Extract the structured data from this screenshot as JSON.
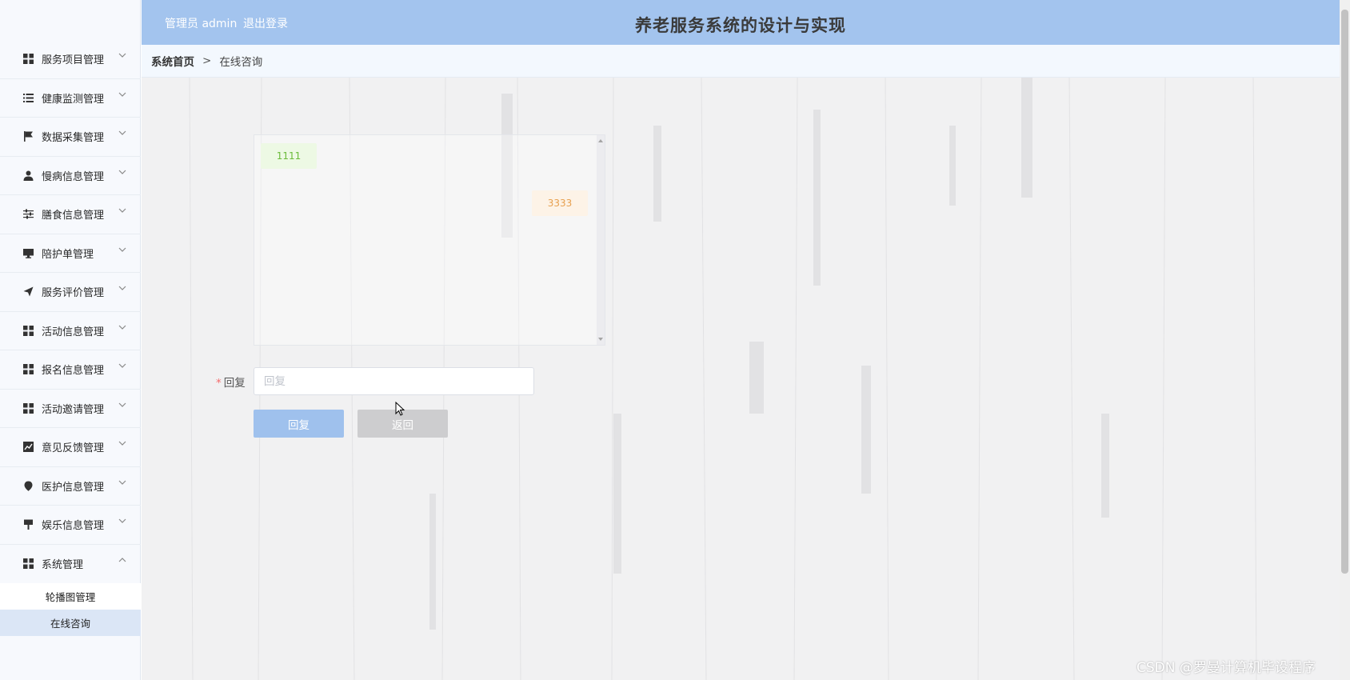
{
  "header": {
    "admin_label": "管理员 admin",
    "logout_label": "退出登录",
    "system_title": "养老服务系统的设计与实现"
  },
  "sidebar": {
    "items": [
      {
        "label": "服务项目管理",
        "icon": "grid-icon"
      },
      {
        "label": "健康监测管理",
        "icon": "list-icon"
      },
      {
        "label": "数据采集管理",
        "icon": "flag-icon"
      },
      {
        "label": "慢病信息管理",
        "icon": "user-icon"
      },
      {
        "label": "膳食信息管理",
        "icon": "sliders-icon"
      },
      {
        "label": "陪护单管理",
        "icon": "monitor-icon"
      },
      {
        "label": "服务评价管理",
        "icon": "send-icon"
      },
      {
        "label": "活动信息管理",
        "icon": "grid-icon"
      },
      {
        "label": "报名信息管理",
        "icon": "grid-icon"
      },
      {
        "label": "活动邀请管理",
        "icon": "grid-icon"
      },
      {
        "label": "意见反馈管理",
        "icon": "chart-icon"
      },
      {
        "label": "医护信息管理",
        "icon": "location-icon"
      },
      {
        "label": "娱乐信息管理",
        "icon": "pin-icon"
      },
      {
        "label": "系统管理",
        "icon": "grid-icon",
        "expanded": true
      }
    ],
    "submenu": [
      {
        "label": "轮播图管理",
        "active": false
      },
      {
        "label": "在线咨询",
        "active": true
      }
    ]
  },
  "breadcrumb": {
    "home": "系统首页",
    "separator": ">",
    "current": "在线咨询"
  },
  "chat": {
    "messages": [
      {
        "side": "left",
        "text": "1111"
      },
      {
        "side": "right",
        "text": "3333"
      }
    ]
  },
  "form": {
    "reply_label": "回复",
    "required_mark": "*",
    "reply_placeholder": "回复",
    "reply_value": "",
    "reply_button": "回复",
    "back_button": "返回"
  },
  "watermark": "CSDN @罗曼计算机毕设程序",
  "colors": {
    "header_bg": "#a3c4ee",
    "reply_button": "#9fc1ed",
    "back_button": "#cdcdcf",
    "msg_left_bg": "#edf9e4",
    "msg_left_text": "#6bbb3a",
    "msg_right_bg": "#fdf3e7",
    "msg_right_text": "#e7a04f"
  }
}
